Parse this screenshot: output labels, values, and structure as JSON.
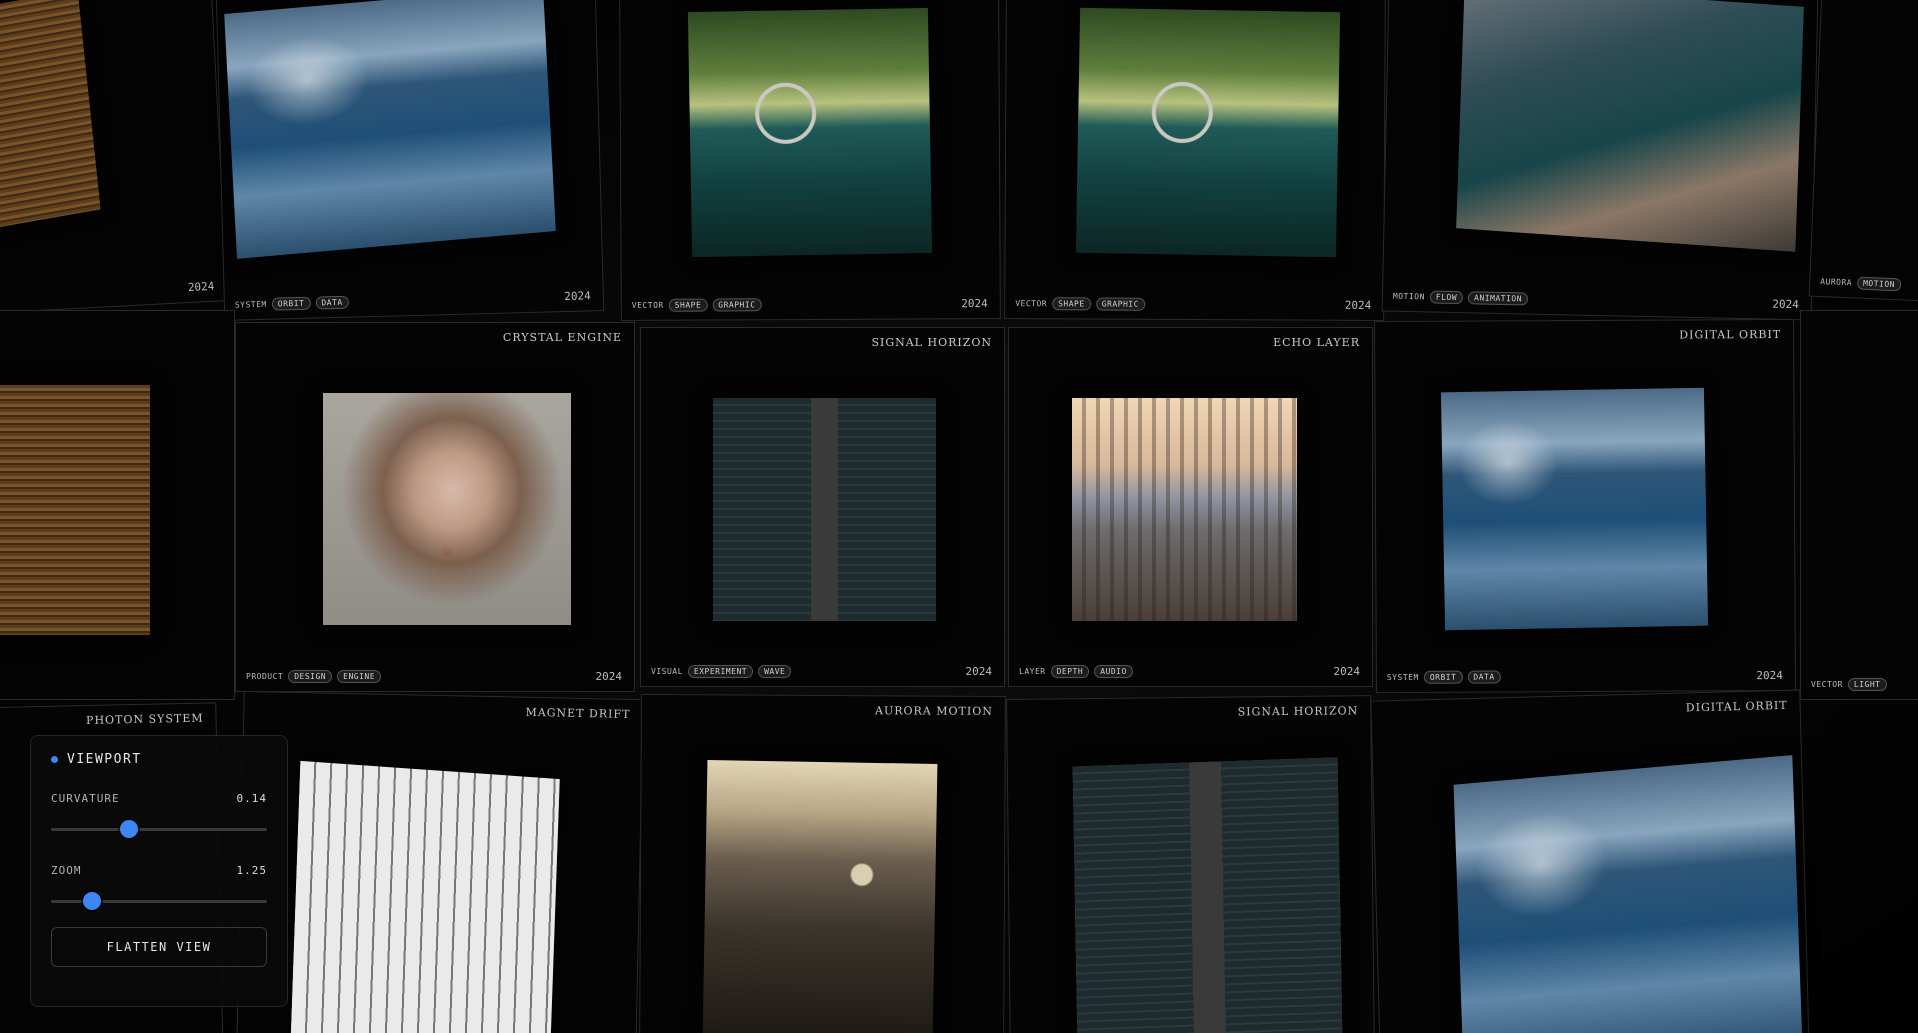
{
  "cards": [
    {
      "title": "",
      "category": "",
      "tags": [],
      "year": "2024",
      "photo": "ph-wood"
    },
    {
      "title": "",
      "category": "SYSTEM",
      "tags": [
        "ORBIT",
        "DATA"
      ],
      "year": "2024",
      "photo": "ph-wave"
    },
    {
      "title": "",
      "category": "VECTOR",
      "tags": [
        "SHAPE",
        "GRAPHIC"
      ],
      "year": "2024",
      "photo": "ph-car"
    },
    {
      "title": "",
      "category": "VECTOR",
      "tags": [
        "SHAPE",
        "GRAPHIC"
      ],
      "year": "2024",
      "photo": "ph-car"
    },
    {
      "title": "",
      "category": "MOTION",
      "tags": [
        "FLOW",
        "ANIMATION"
      ],
      "year": "2024",
      "photo": "ph-coast"
    },
    {
      "title": "",
      "category": "AURORA",
      "tags": [
        "MOTION"
      ],
      "year": "",
      "photo": ""
    },
    {
      "title": "",
      "category": "",
      "tags": [],
      "year": "",
      "photo": "ph-wood"
    },
    {
      "title": "CRYSTAL ENGINE",
      "category": "PRODUCT",
      "tags": [
        "DESIGN",
        "ENGINE"
      ],
      "year": "2024",
      "photo": "ph-portrait"
    },
    {
      "title": "SIGNAL HORIZON",
      "category": "VISUAL",
      "tags": [
        "EXPERIMENT",
        "WAVE"
      ],
      "year": "2024",
      "photo": "ph-escalator"
    },
    {
      "title": "ECHO LAYER",
      "category": "LAYER",
      "tags": [
        "DEPTH",
        "AUDIO"
      ],
      "year": "2024",
      "photo": "ph-city"
    },
    {
      "title": "DIGITAL ORBIT",
      "category": "SYSTEM",
      "tags": [
        "ORBIT",
        "DATA"
      ],
      "year": "2024",
      "photo": "ph-wave"
    },
    {
      "title": "",
      "category": "VECTOR",
      "tags": [
        "LIGHT"
      ],
      "year": "",
      "photo": ""
    },
    {
      "title": "PHOTON SYSTEM",
      "category": "",
      "tags": [],
      "year": "",
      "photo": "ph-wood"
    },
    {
      "title": "MAGNET DRIFT",
      "category": "",
      "tags": [],
      "year": "",
      "photo": "ph-piano"
    },
    {
      "title": "AURORA MOTION",
      "category": "",
      "tags": [],
      "year": "",
      "photo": "ph-oldcar"
    },
    {
      "title": "SIGNAL HORIZON",
      "category": "",
      "tags": [],
      "year": "",
      "photo": "ph-escalator"
    },
    {
      "title": "DIGITAL ORBIT",
      "category": "",
      "tags": [],
      "year": "",
      "photo": "ph-wave"
    }
  ],
  "panel": {
    "title": "VIEWPORT",
    "curvature_label": "CURVATURE",
    "curvature_value": "0.14",
    "curvature_fraction": 0.36,
    "zoom_label": "ZOOM",
    "zoom_value": "1.25",
    "zoom_fraction": 0.19,
    "button_label": "FLATTEN VIEW",
    "accent_color": "#3d86f5"
  }
}
